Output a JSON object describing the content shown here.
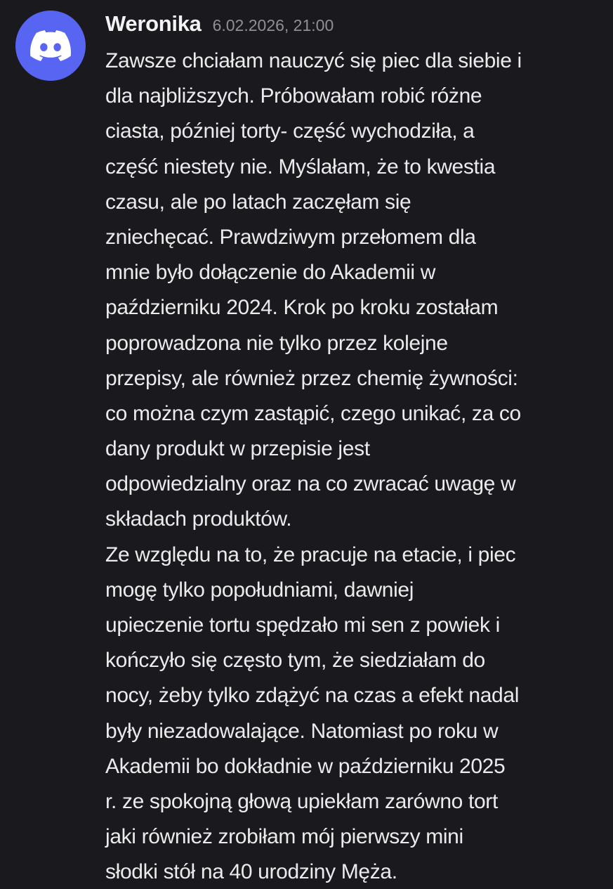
{
  "author": {
    "username": "Weronika",
    "timestamp": "6.02.2026, 21:00",
    "avatar_icon": "discord-logo-icon",
    "avatar_color": "#5865f2"
  },
  "message": {
    "lines": [
      "Zawsze chciałam nauczyć się piec dla siebie i",
      "dla najbliższych. Próbowałam robić różne",
      "ciasta, później torty- część wychodziła, a",
      "część niestety nie. Myślałam, że to kwestia",
      "czasu, ale po latach zaczęłam się",
      "zniechęcać. Prawdziwym przełomem dla",
      "mnie było dołączenie do Akademii w",
      "październiku 2024. Krok po kroku zostałam",
      "poprowadzona nie tylko przez kolejne",
      "przepisy, ale również przez chemię żywności:",
      "co można czym zastąpić, czego unikać, za co",
      "dany produkt w przepisie jest",
      "odpowiedzialny oraz na co zwracać uwagę w",
      "składach produktów.",
      "Ze względu na to, że pracuje na etacie, i piec",
      "mogę tylko popołudniami, dawniej",
      "upieczenie tortu spędzało mi sen z powiek i",
      "kończyło się często tym, że siedziałam do",
      "nocy, żeby tylko zdążyć na czas a efekt nadal",
      "były niezadowalające. Natomiast po roku w",
      "Akademii bo dokładnie w październiku 2025",
      "r. ze spokojną głową upiekłam zarówno tort",
      "jaki również zrobiłam mój pierwszy mini",
      "słodki stół na 40 urodziny Męża."
    ]
  }
}
